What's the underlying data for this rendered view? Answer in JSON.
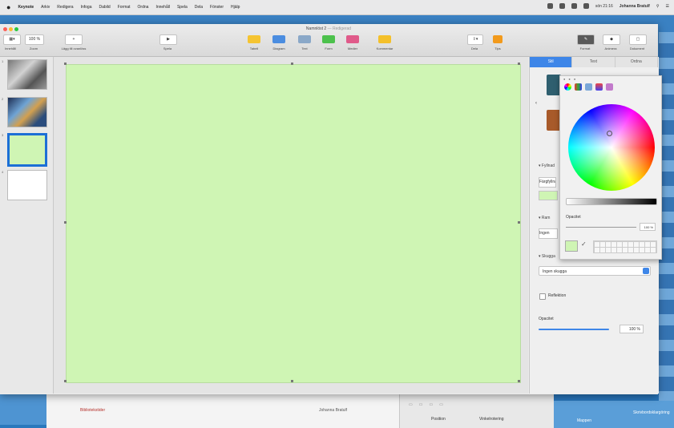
{
  "menubar": {
    "app": "Keynote",
    "items": [
      "Arkiv",
      "Redigera",
      "Infoga",
      "Dabild",
      "Format",
      "Ordna",
      "Innehåll",
      "Spela",
      "Dela",
      "Fönster",
      "Hjälp"
    ],
    "status_time": "sön 21:16",
    "user": "Johanna Bratulf"
  },
  "window": {
    "title": "Namnlöst 2",
    "edited": "— Redigerad",
    "toolbar": {
      "view_label": "Innehåll",
      "zoom_value": "100 %",
      "zoom_label": "Zoom",
      "add_slide_label": "Lägg till ovanlöss",
      "play_label": "Spela",
      "table_label": "Tabell",
      "chart_label": "Diagram",
      "text_label": "Text",
      "shape_label": "Form",
      "media_label": "Medier",
      "comment_label": "Kommentar",
      "share_label": "Dela",
      "tips_label": "Tips",
      "format_label": "Format",
      "animate_label": "Animera",
      "document_label": "Dokument"
    }
  },
  "navigator": {
    "slides": [
      {
        "num": "1"
      },
      {
        "num": "2"
      },
      {
        "num": "3"
      },
      {
        "num": "4"
      }
    ],
    "selected": 3
  },
  "slide": {
    "background": "#cff5b4"
  },
  "inspector": {
    "tabs": [
      "Stil",
      "Text",
      "Ordna"
    ],
    "active_tab": "Stil",
    "fill_section": "Fyllnad",
    "fill_value": "Färgfyllnad",
    "border_section": "Ram",
    "border_value": "Ingen ram",
    "shadow_section": "Skugga",
    "shadow_value": "Ingen skugga",
    "reflection_label": "Reflektion",
    "opacity_label": "Opacitet",
    "opacity_value": "100 %",
    "swatch_colors": [
      "#2f5f6f",
      "#a85a2a"
    ]
  },
  "color_picker": {
    "opacity_label": "Opacitet",
    "opacity_value": "100 %",
    "current_color": "#cff5b4"
  },
  "background_window": {
    "document_name": "Bibliotekstider",
    "author": "Johanna Bratulf",
    "position_label": "Position",
    "rotation_label": "Vinkelrotering"
  },
  "desktop": {
    "label1": "Mappen",
    "label2": "Skrivbordsklargöring"
  }
}
